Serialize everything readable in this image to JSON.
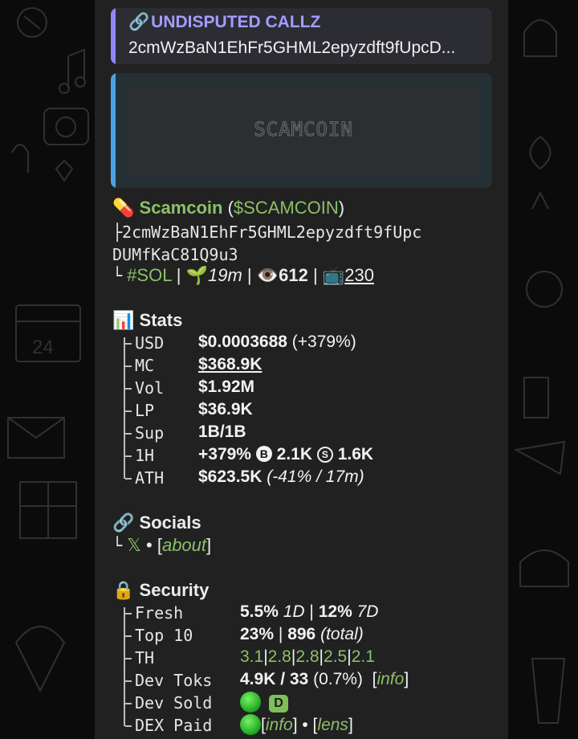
{
  "reply": {
    "title": "UNDISPUTED CALLZ",
    "address": "2cmWzBaN1EhFr5GHML2epyzdft9fUpcD..."
  },
  "preview": {
    "image_label": "SCAMCOIN"
  },
  "token": {
    "name": "Scamcoin",
    "ticker": "$SCAMCOIN",
    "address_line1": "2cmWzBaN1EhFr5GHML2epyzdft9fUpc",
    "address_line2": "DUMfKaC81Q9u3",
    "chain": "#SOL",
    "age": "19m",
    "views": "612",
    "tv": "230"
  },
  "stats": {
    "heading": "Stats",
    "rows": [
      {
        "key": "USD",
        "value": "$0.0003688",
        "extra": " (+379%)"
      },
      {
        "key": "MC",
        "value": "$368.9K",
        "extra": ""
      },
      {
        "key": "Vol",
        "value": "$1.92M",
        "extra": ""
      },
      {
        "key": "LP",
        "value": "$36.9K",
        "extra": ""
      },
      {
        "key": "Sup",
        "value": "1B/1B",
        "extra": ""
      },
      {
        "key": "1H",
        "value": "+379%",
        "buys": "2.1K",
        "sells": "1.6K"
      },
      {
        "key": "ATH",
        "value": "$623.5K",
        "extra": "(-41% / 17m)"
      }
    ]
  },
  "socials": {
    "heading": "Socials",
    "x": "𝕏",
    "about": "about"
  },
  "security": {
    "heading": "Security",
    "fresh": {
      "key": "Fresh",
      "v1": "5.5%",
      "p1": "1D",
      "v2": "12%",
      "p2": "7D"
    },
    "top10": {
      "key": "Top 10",
      "v1": "23%",
      "v2": "896",
      "p2": "(total)"
    },
    "th": {
      "key": "TH",
      "values": [
        "3.1",
        "2.8",
        "2.8",
        "2.5",
        "2.1"
      ]
    },
    "dev_toks": {
      "key": "Dev Toks",
      "value": "4.9K / 33",
      "extra": "(0.7%)",
      "link": "info"
    },
    "dev_sold": {
      "key": "Dev Sold",
      "badge": "D"
    },
    "dex_paid": {
      "key": "DEX Paid",
      "link1": "info",
      "link2": "lens"
    }
  },
  "colors": {
    "accent_green": "#8cc068",
    "reply_accent": "#8f86ff",
    "preview_accent": "#4aa3e8"
  }
}
